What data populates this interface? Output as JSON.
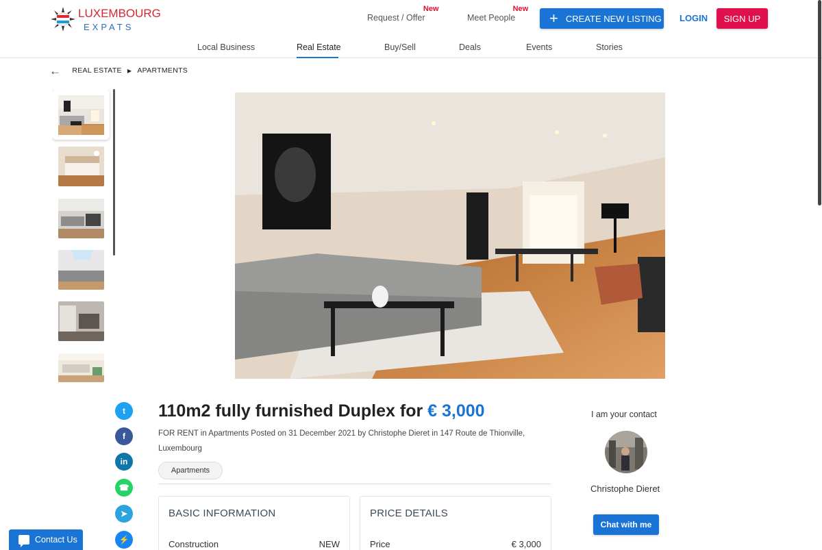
{
  "header": {
    "logo": {
      "line1": "LUXEMBOURG",
      "line2": "EXPATS"
    },
    "links": [
      {
        "label": "Request / Offer",
        "badge": "New"
      },
      {
        "label": "Meet People",
        "badge": "New"
      }
    ],
    "create_label": "CREATE NEW LISTING",
    "login_label": "LOGIN",
    "signup_label": "SIGN UP"
  },
  "nav": {
    "items": [
      "Local Business",
      "Real Estate",
      "Buy/Sell",
      "Deals",
      "Events",
      "Stories"
    ],
    "active": "Real Estate"
  },
  "breadcrumb": [
    "REAL ESTATE",
    "APARTMENTS"
  ],
  "listing": {
    "title": "110m2 fully furnished Duplex for",
    "price": "€ 3,000",
    "meta": "FOR RENT in Apartments Posted on 31 December 2021 by Christophe Dieret in 147 Route de Thionville, Luxembourg",
    "tag": "Apartments"
  },
  "basic_info": {
    "heading": "BASIC INFORMATION",
    "rows": [
      {
        "label": "Construction",
        "value": "NEW"
      }
    ]
  },
  "price_details": {
    "heading": "PRICE DETAILS",
    "rows": [
      {
        "label": "Price",
        "value": "€ 3,000"
      }
    ]
  },
  "contact": {
    "heading": "I am your contact",
    "name": "Christophe Dieret",
    "chat_label": "Chat with me"
  },
  "share": [
    "twitter-icon",
    "facebook-icon",
    "linkedin-icon",
    "whatsapp-icon",
    "telegram-icon",
    "messenger-icon"
  ],
  "contact_us_label": "Contact Us",
  "colors": {
    "primary": "#1a74d6",
    "signup": "#e0104f",
    "badge": "#e0102e"
  }
}
